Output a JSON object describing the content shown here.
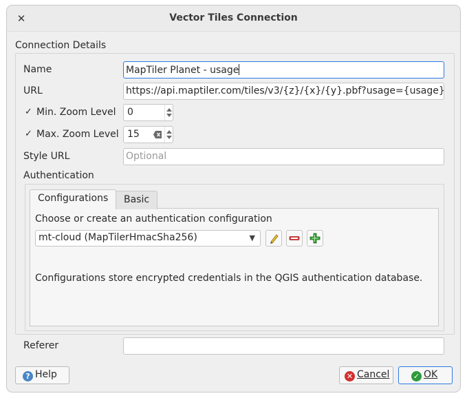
{
  "window": {
    "title": "Vector Tiles Connection",
    "close_glyph": "✕"
  },
  "connection": {
    "group_title": "Connection Details",
    "name_label": "Name",
    "name_value": "MapTiler Planet - usage",
    "url_label": "URL",
    "url_value": "https://api.maptiler.com/tiles/v3/{z}/{x}/{y}.pbf?usage={usage}",
    "min_zoom": {
      "checked": true,
      "label": "Min. Zoom Level",
      "value": "0"
    },
    "max_zoom": {
      "checked": true,
      "label": "Max. Zoom Level",
      "value": "15"
    },
    "style_url_label": "Style URL",
    "style_url_placeholder": "Optional",
    "check_glyph": "✓"
  },
  "authentication": {
    "title": "Authentication",
    "tabs": [
      {
        "label": "Configurations",
        "active": true
      },
      {
        "label": "Basic",
        "active": false
      }
    ],
    "choose_label": "Choose or create an authentication configuration",
    "selected_config": "mt-cloud (MapTilerHmacSha256)",
    "info_text": "Configurations store encrypted credentials in the QGIS authentication database."
  },
  "referer": {
    "label": "Referer",
    "value": ""
  },
  "buttons": {
    "help_label": "Help",
    "cancel_label": "Cancel",
    "ok_label": "OK"
  },
  "icons": {
    "close": "close-icon",
    "edit": "pencil-icon",
    "remove": "minus-icon",
    "add": "plus-icon",
    "help": "help-icon",
    "cancel": "cancel-icon",
    "ok": "check-circle-icon"
  },
  "colors": {
    "focus": "#2b78e4",
    "help_icon": "#4a86c8",
    "cancel_icon": "#d03030",
    "ok_icon": "#2e9a3a",
    "remove_icon": "#d84040",
    "add_icon": "#2f9e2f"
  }
}
